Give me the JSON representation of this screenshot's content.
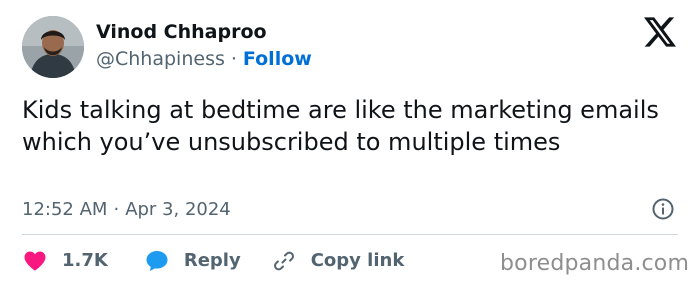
{
  "author": {
    "name": "Vinod Chhaproo",
    "handle": "@Chhapiness",
    "separator": "·",
    "follow_label": "Follow"
  },
  "tweet": {
    "text": "Kids talking at bedtime are like the marketing emails which you’ve unsubscribed to multiple times"
  },
  "meta": {
    "time": "12:52 AM",
    "separator": "·",
    "date": "Apr 3, 2024"
  },
  "actions": {
    "like_count": "1.7K",
    "reply_label": "Reply",
    "copy_link_label": "Copy link"
  },
  "watermark": "boredpanda.com",
  "colors": {
    "link_blue": "#006fd6",
    "like_red": "#f91880",
    "reply_blue": "#1d9bf0",
    "muted_text": "#536471",
    "main_text": "#0f1419",
    "divider": "#cfd9de"
  },
  "icons": [
    "avatar-photo",
    "x-logo-icon",
    "info-icon",
    "heart-icon",
    "reply-bubble-icon",
    "link-icon"
  ]
}
